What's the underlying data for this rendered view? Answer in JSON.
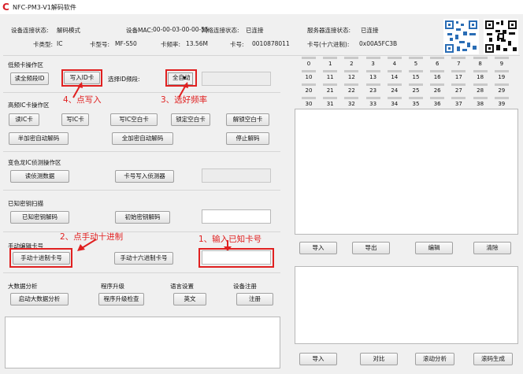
{
  "app": {
    "title": "NFC-PM3-V1解码软件"
  },
  "status": {
    "device_state_label": "设备连接状态:",
    "device_state": "解码模式",
    "mac_label": "设备MAC:",
    "mac": "00-00-03-00-00-55",
    "net_label": "网络连接状态:",
    "net": "已连接",
    "server_label": "服务器连接状态:",
    "server": "已连接",
    "card_type_label": "卡类型:",
    "card_type": "IC",
    "card_model_label": "卡型号:",
    "card_model": "MF-S50",
    "freq_label": "卡频率:",
    "freq": "13.56M",
    "card_no_label": "卡号:",
    "card_no": "0010878011",
    "card_hex_label": "卡号(十六进制):",
    "card_hex": "0x00A5FC3B"
  },
  "id_section": {
    "title": "低频卡操作区",
    "read_btn": "读全频段ID",
    "write_btn": "写入ID卡",
    "freq_label": "选择ID频段:",
    "freq_value": "全自动",
    "dropdown_arrow": "▼"
  },
  "ic_section": {
    "title": "高频IC卡操作区",
    "buttons": [
      "读IC卡",
      "写IC卡",
      "写IC空白卡",
      "锁定空白卡",
      "解锁空白卡"
    ],
    "half_btn": "半加密自动解码",
    "full_btn": "全加密自动解码",
    "stop_btn": "停止解码"
  },
  "detector_section": {
    "title": "变色龙IC侦测操作区",
    "read_btn": "读侦测数据",
    "write_btn": "卡号写入侦测器"
  },
  "known_key_section": {
    "title": "已知密钥扫描",
    "decode_btn": "已知密钥解码",
    "init_btn": "初始密钥解码"
  },
  "manual_section": {
    "title": "手动编辑卡号",
    "dec_btn": "手动十进制卡号",
    "hex_btn": "手动十六进制卡号"
  },
  "bottom": {
    "bigdata_title": "大数据分析",
    "bigdata_btn": "启动大数据分析",
    "upgrade_title": "程序升级",
    "upgrade_btn": "程序升级检查",
    "lang_title": "语言设置",
    "lang_btn": "英文",
    "reg_title": "设备注册",
    "reg_btn": "注册"
  },
  "sector_grid": {
    "rows": [
      [
        "0",
        "1",
        "2",
        "3",
        "4",
        "5",
        "6",
        "7",
        "8",
        "9"
      ],
      [
        "10",
        "11",
        "12",
        "13",
        "14",
        "15",
        "16",
        "17",
        "18",
        "19"
      ],
      [
        "20",
        "21",
        "22",
        "23",
        "24",
        "25",
        "26",
        "27",
        "28",
        "29"
      ],
      [
        "30",
        "31",
        "32",
        "33",
        "34",
        "35",
        "36",
        "37",
        "38",
        "39"
      ]
    ]
  },
  "right_panel": {
    "mid_buttons": [
      "导入",
      "导出",
      "编辑",
      "清除"
    ],
    "bottom_buttons": [
      "导入",
      "对比",
      "滚动分析",
      "滚码生成"
    ]
  },
  "annotations": {
    "a1": "1、输入已知卡号",
    "a2": "2、点手动十进制",
    "a3": "3、选好频率",
    "a4": "4、点写入"
  },
  "colors": {
    "annotation": "#e02020",
    "logo": "#d8202a"
  }
}
